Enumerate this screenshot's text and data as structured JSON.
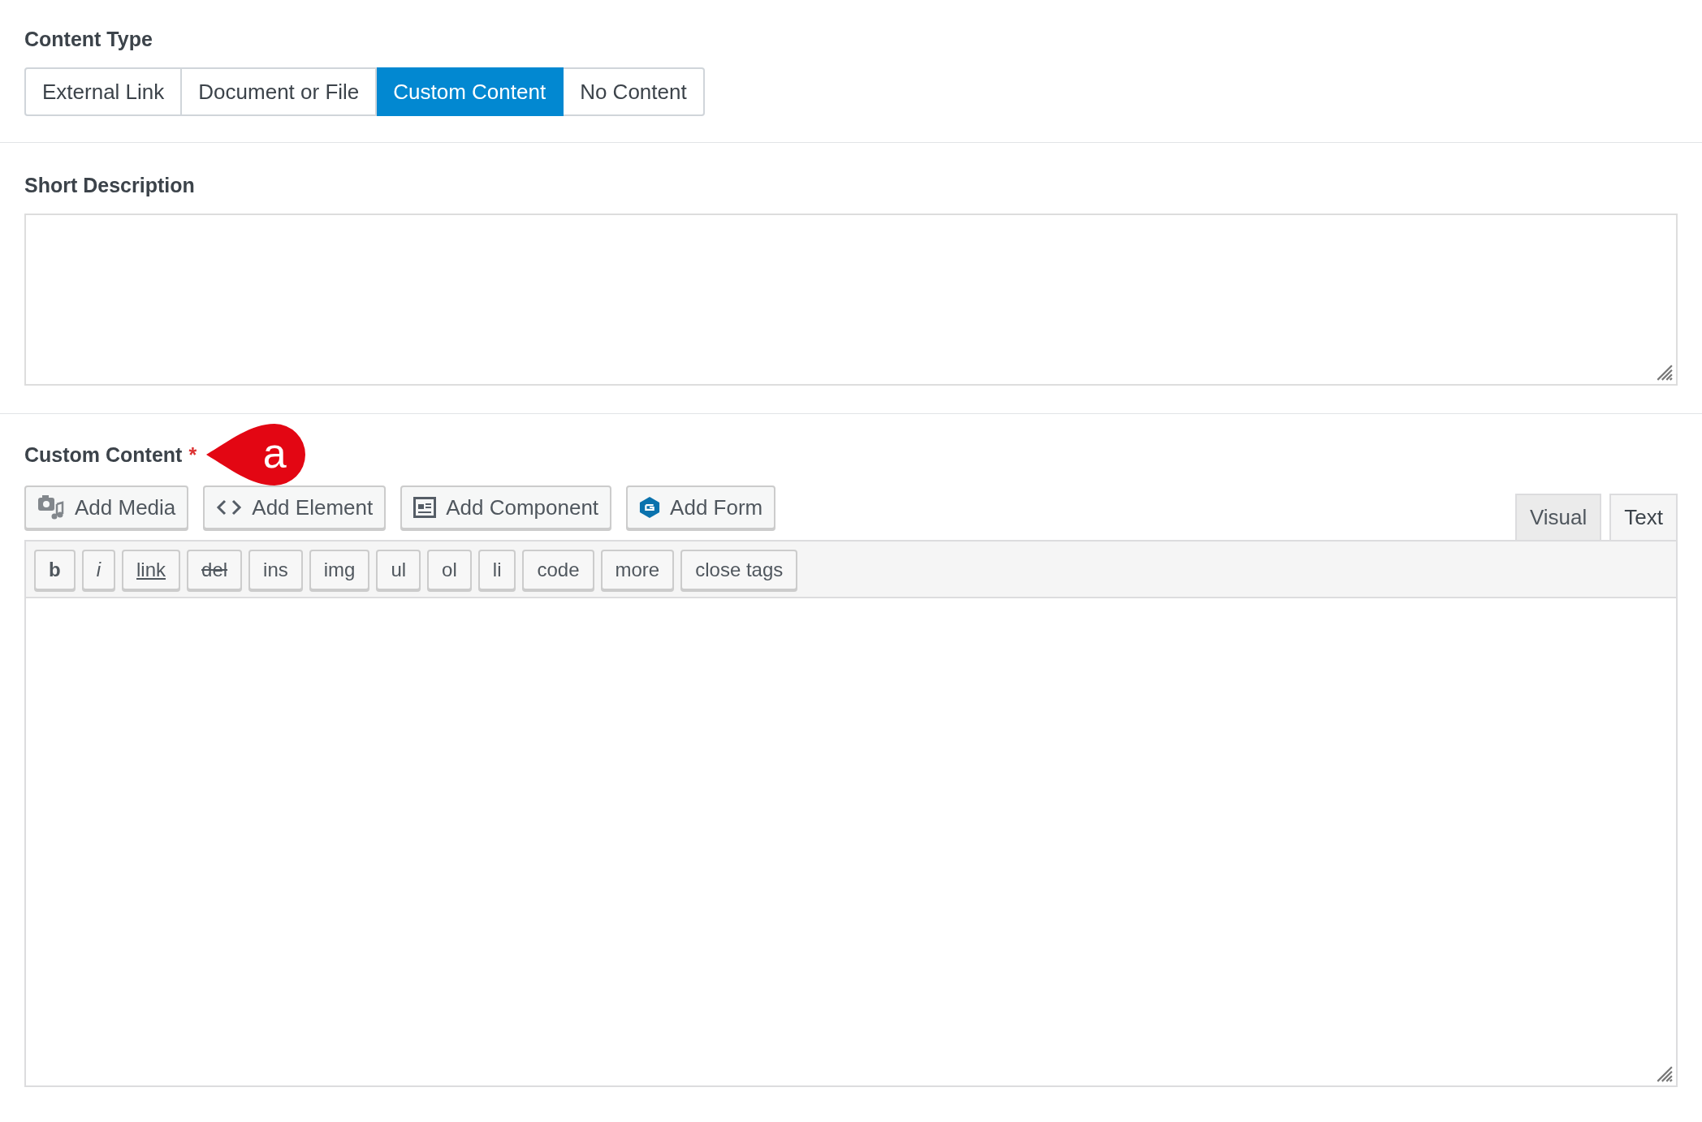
{
  "content_type": {
    "label": "Content Type",
    "options": [
      {
        "label": "External Link",
        "selected": false
      },
      {
        "label": "Document or File",
        "selected": false
      },
      {
        "label": "Custom Content",
        "selected": true
      },
      {
        "label": "No Content",
        "selected": false
      }
    ]
  },
  "short_description": {
    "label": "Short Description"
  },
  "custom_content": {
    "label": "Custom Content",
    "required_mark": "*",
    "callout": "a",
    "media_buttons": [
      {
        "kind": "media",
        "label": "Add Media"
      },
      {
        "kind": "element",
        "label": "Add Element"
      },
      {
        "kind": "component",
        "label": "Add Component"
      },
      {
        "kind": "form",
        "label": "Add Form"
      }
    ],
    "editor_tabs": [
      {
        "label": "Visual",
        "selected": false
      },
      {
        "label": "Text",
        "selected": true
      }
    ],
    "quicktags": [
      {
        "kind": "bold",
        "label": "b"
      },
      {
        "kind": "italic",
        "label": "i"
      },
      {
        "kind": "underline",
        "label": "link"
      },
      {
        "kind": "strike",
        "label": "del"
      },
      {
        "kind": "plain",
        "label": "ins"
      },
      {
        "kind": "plain",
        "label": "img"
      },
      {
        "kind": "plain",
        "label": "ul"
      },
      {
        "kind": "plain",
        "label": "ol"
      },
      {
        "kind": "plain",
        "label": "li"
      },
      {
        "kind": "plain",
        "label": "code"
      },
      {
        "kind": "plain",
        "label": "more"
      },
      {
        "kind": "plain",
        "label": "close tags"
      }
    ]
  }
}
